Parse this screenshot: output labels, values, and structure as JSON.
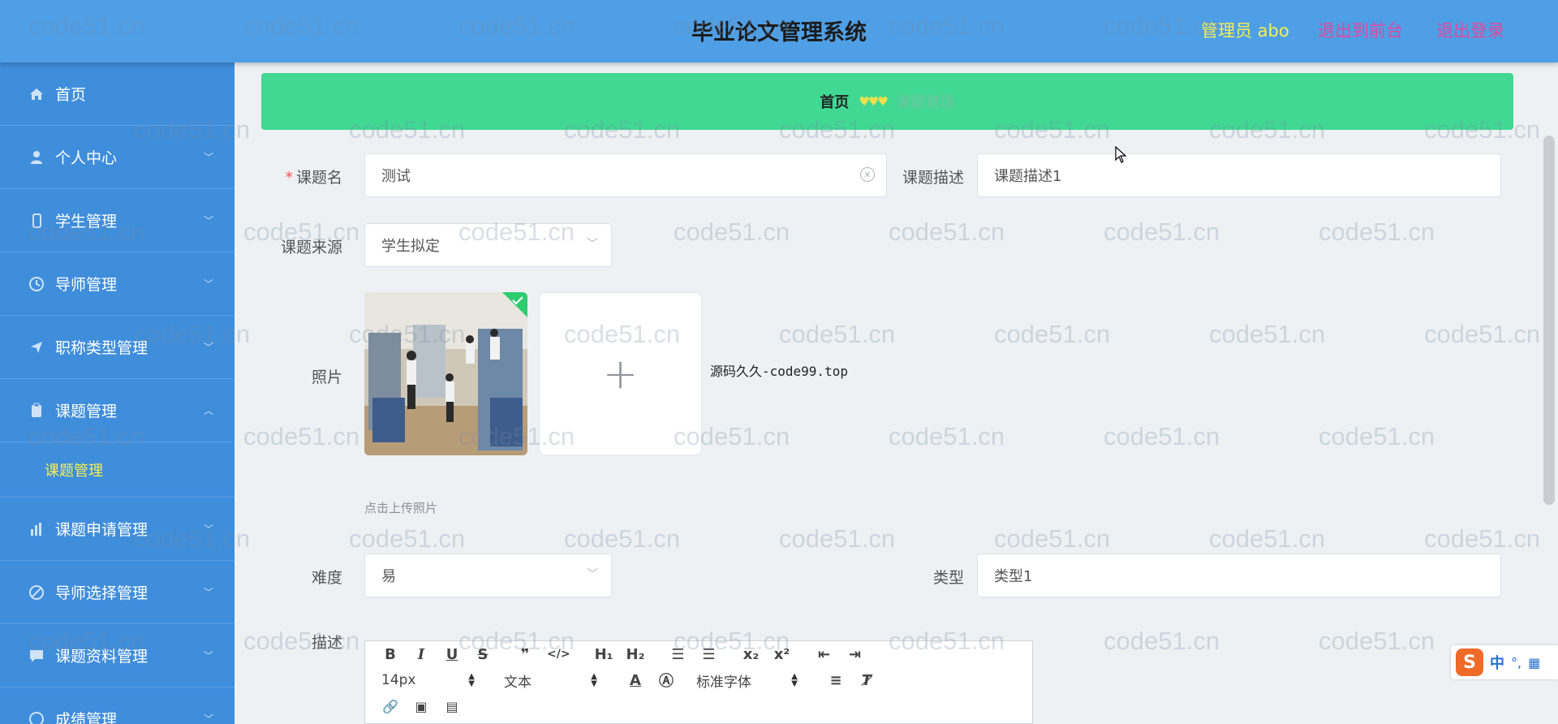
{
  "header": {
    "title": "毕业论文管理系统",
    "admin_label": "管理员 abo",
    "back_front_label": "退出到前台",
    "logout_label": "退出登录"
  },
  "sidebar": {
    "items": [
      {
        "label": "首页",
        "icon": "home-icon"
      },
      {
        "label": "个人中心",
        "icon": "user-icon"
      },
      {
        "label": "学生管理",
        "icon": "phone-icon"
      },
      {
        "label": "导师管理",
        "icon": "clock-icon"
      },
      {
        "label": "职称类型管理",
        "icon": "send-icon"
      },
      {
        "label": "课题管理",
        "icon": "clipboard-icon"
      },
      {
        "label": "课题申请管理",
        "icon": "chart-icon"
      },
      {
        "label": "导师选择管理",
        "icon": "edit-icon"
      },
      {
        "label": "课题资料管理",
        "icon": "chat-icon"
      },
      {
        "label": "成绩管理",
        "icon": "star-icon"
      }
    ],
    "active_submenu": "课题管理"
  },
  "breadcrumb": {
    "home": "首页",
    "separator": "♥♥♥",
    "current": "课题管理"
  },
  "form": {
    "topic_name_label": "课题名",
    "topic_name_value": "测试",
    "topic_desc_label": "课题描述",
    "topic_desc_value": "课题描述1",
    "topic_source_label": "课题来源",
    "topic_source_value": "学生拟定",
    "photo_label": "照片",
    "upload_hint": "点击上传照片",
    "source_text": "源码久久-code99.top",
    "difficulty_label": "难度",
    "difficulty_value": "易",
    "type_label": "类型",
    "type_value": "类型1",
    "description_label": "描述"
  },
  "editor": {
    "font_size": "14px",
    "text_style": "文本",
    "font_family": "标准字体"
  },
  "watermark": "code51.cn",
  "ime": {
    "zh": "中",
    "dot": "°,"
  },
  "colors": {
    "header_bg": "#4e9fe6",
    "sidebar_bg": "#3f8edc",
    "breadcrumb_bg": "#41d894",
    "accent_yellow": "#f6ef4f",
    "accent_pink": "#e04a9f"
  }
}
